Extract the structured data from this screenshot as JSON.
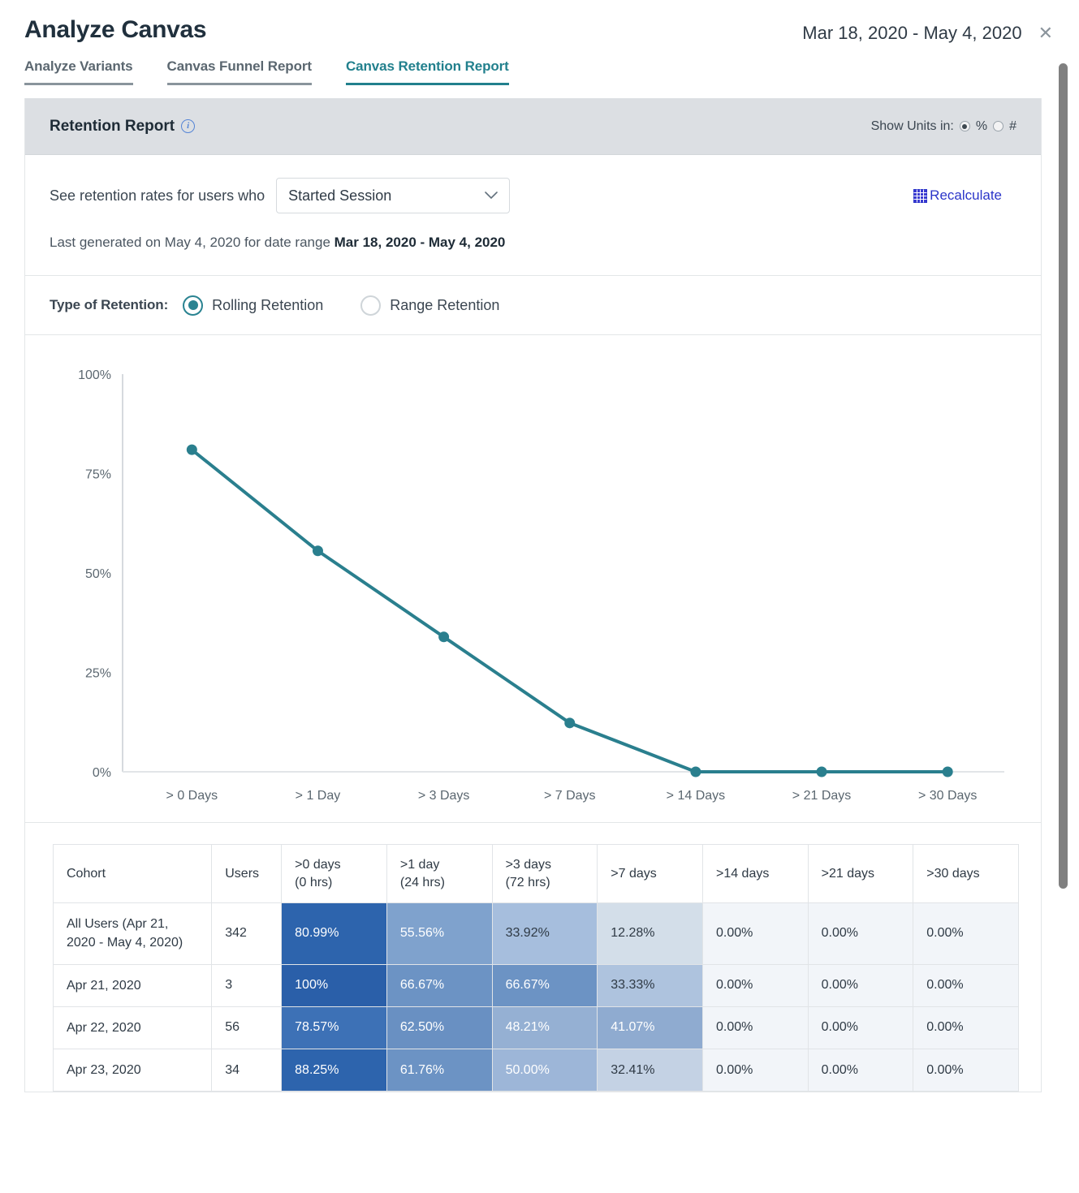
{
  "header": {
    "title": "Analyze Canvas",
    "date_range": "Mar 18, 2020 - May 4, 2020",
    "close_icon": "close-icon"
  },
  "tabs": [
    {
      "label": "Analyze Variants",
      "active": false
    },
    {
      "label": "Canvas Funnel Report",
      "active": false
    },
    {
      "label": "Canvas Retention Report",
      "active": true
    }
  ],
  "report": {
    "panel_title": "Retention Report",
    "info_icon": "info-icon",
    "units": {
      "label": "Show Units in:",
      "options": [
        {
          "label": "%",
          "selected": true
        },
        {
          "label": "#",
          "selected": false
        }
      ]
    },
    "query": {
      "label": "See retention rates for users who",
      "select_value": "Started Session",
      "chevron_icon": "chevron-down-icon",
      "recalculate_label": "Recalculate",
      "recalculate_icon": "grid-calculator-icon"
    },
    "generated": {
      "prefix": "Last generated on May 4, 2020 for date range ",
      "range": "Mar 18, 2020 - May 4, 2020"
    },
    "retention_type": {
      "label": "Type of Retention:",
      "options": [
        {
          "label": "Rolling Retention",
          "selected": true
        },
        {
          "label": "Range Retention",
          "selected": false
        }
      ]
    }
  },
  "chart_data": {
    "type": "line",
    "title": "",
    "xlabel": "",
    "ylabel": "",
    "categories": [
      "> 0 Days",
      "> 1 Day",
      "> 3 Days",
      "> 7 Days",
      "> 14 Days",
      "> 21 Days",
      "> 30 Days"
    ],
    "series": [
      {
        "name": "All Users",
        "values": [
          80.99,
          55.56,
          33.92,
          12.28,
          0.0,
          0.0,
          0.0
        ]
      }
    ],
    "ylim": [
      0,
      100
    ],
    "ytick_labels": [
      "100%",
      "75%",
      "50%",
      "25%",
      "0%"
    ],
    "ytick_values": [
      100,
      75,
      50,
      25,
      0
    ],
    "grid": false,
    "legend": "none",
    "line_color": "#2a7f8e",
    "point_color": "#2a7f8e"
  },
  "table": {
    "columns": [
      {
        "label": "Cohort",
        "sub": ""
      },
      {
        "label": "Users",
        "sub": ""
      },
      {
        "label": ">0 days",
        "sub": "(0 hrs)"
      },
      {
        "label": ">1 day",
        "sub": "(24 hrs)"
      },
      {
        "label": ">3 days",
        "sub": "(72 hrs)"
      },
      {
        "label": ">7 days",
        "sub": ""
      },
      {
        "label": ">14 days",
        "sub": ""
      },
      {
        "label": ">21 days",
        "sub": ""
      },
      {
        "label": ">30 days",
        "sub": ""
      }
    ],
    "rows": [
      {
        "cohort": "All Users (Apr 21, 2020 - May 4, 2020)",
        "users": "342",
        "values": [
          "80.99%",
          "55.56%",
          "33.92%",
          "12.28%",
          "0.00%",
          "0.00%",
          "0.00%"
        ],
        "colors": [
          "#2d64ad",
          "#7fa2cd",
          "#a6bedd",
          "#d3dee9",
          "#f2f5f9",
          "#f2f5f9",
          "#f2f5f9"
        ],
        "text_colors": [
          "#ffffff",
          "#ffffff",
          "#2f3a45",
          "#2f3a45",
          "#2f3a45",
          "#2f3a45",
          "#2f3a45"
        ]
      },
      {
        "cohort": "Apr 21, 2020",
        "users": "3",
        "values": [
          "100%",
          "66.67%",
          "66.67%",
          "33.33%",
          "0.00%",
          "0.00%",
          "0.00%"
        ],
        "colors": [
          "#2a5fa9",
          "#6c93c4",
          "#6c93c4",
          "#aec3de",
          "#f2f5f9",
          "#f2f5f9",
          "#f2f5f9"
        ],
        "text_colors": [
          "#ffffff",
          "#ffffff",
          "#ffffff",
          "#2f3a45",
          "#2f3a45",
          "#2f3a45",
          "#2f3a45"
        ]
      },
      {
        "cohort": "Apr 22, 2020",
        "users": "56",
        "values": [
          "78.57%",
          "62.50%",
          "48.21%",
          "41.07%",
          "0.00%",
          "0.00%",
          "0.00%"
        ],
        "colors": [
          "#3d71b6",
          "#6990c2",
          "#95b0d3",
          "#8fabd0",
          "#f2f5f9",
          "#f2f5f9",
          "#f2f5f9"
        ],
        "text_colors": [
          "#ffffff",
          "#ffffff",
          "#ffffff",
          "#ffffff",
          "#2f3a45",
          "#2f3a45",
          "#2f3a45"
        ]
      },
      {
        "cohort": "Apr 23, 2020",
        "users": "34",
        "values": [
          "88.25%",
          "61.76%",
          "50.00%",
          "32.41%",
          "0.00%",
          "0.00%",
          "0.00%"
        ],
        "colors": [
          "#2d64ad",
          "#6c93c4",
          "#9db6d8",
          "#c4d2e4",
          "#f2f5f9",
          "#f2f5f9",
          "#f2f5f9"
        ],
        "text_colors": [
          "#ffffff",
          "#ffffff",
          "#ffffff",
          "#2f3a45",
          "#2f3a45",
          "#2f3a45",
          "#2f3a45"
        ]
      }
    ]
  },
  "scrollbar": {
    "name": "vertical-scrollbar"
  }
}
